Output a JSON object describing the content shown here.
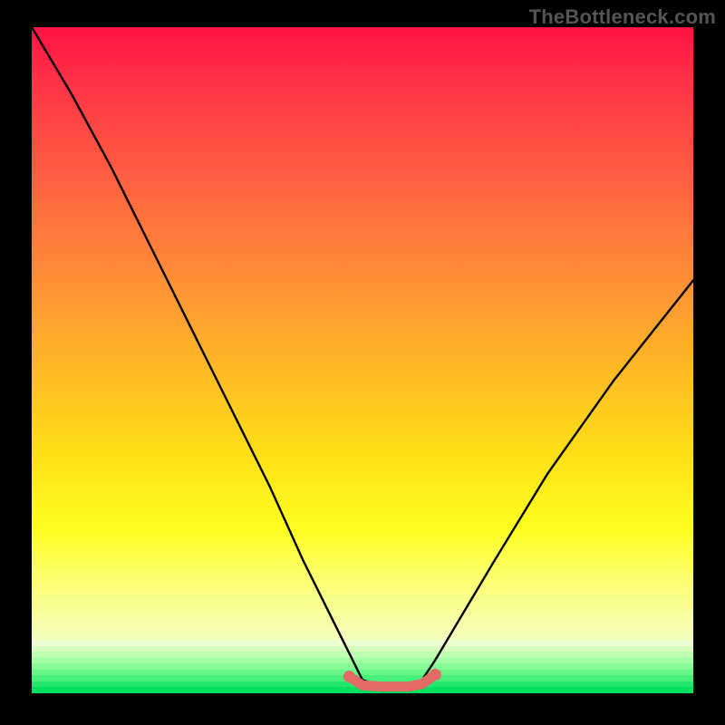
{
  "watermark": "TheBottleneck.com",
  "chart_data": {
    "type": "line",
    "title": "",
    "xlabel": "",
    "ylabel": "",
    "xlim": [
      0,
      100
    ],
    "ylim": [
      0,
      100
    ],
    "grid": false,
    "series": [
      {
        "name": "curve",
        "color": "#000000",
        "x": [
          0,
          6,
          12,
          18,
          24,
          30,
          36,
          41,
          45,
          48,
          50,
          53,
          55,
          57,
          59,
          61,
          64,
          70,
          78,
          88,
          100
        ],
        "y": [
          100,
          90,
          79,
          67,
          55,
          43,
          31,
          20,
          12,
          6,
          2,
          1,
          1,
          1,
          2,
          5,
          10,
          20,
          33,
          47,
          62
        ]
      },
      {
        "name": "bottleneck-band",
        "color": "#e46a65",
        "x": [
          48,
          50,
          53,
          55,
          57,
          59,
          61
        ],
        "y": [
          2.5,
          1.2,
          1.0,
          1.0,
          1.0,
          1.4,
          2.8
        ]
      }
    ],
    "gradient_background": {
      "top_color": "#ff1244",
      "mid_color": "#ffe016",
      "bottom_color": "#00e26a",
      "orientation": "vertical"
    },
    "green_bottom_stripes": [
      "#ecffd0",
      "#d8ffc0",
      "#bfffb2",
      "#a3ffa4",
      "#86fb96",
      "#68f688",
      "#48ef7a",
      "#22e86c",
      "#00e060"
    ],
    "annotations": []
  }
}
